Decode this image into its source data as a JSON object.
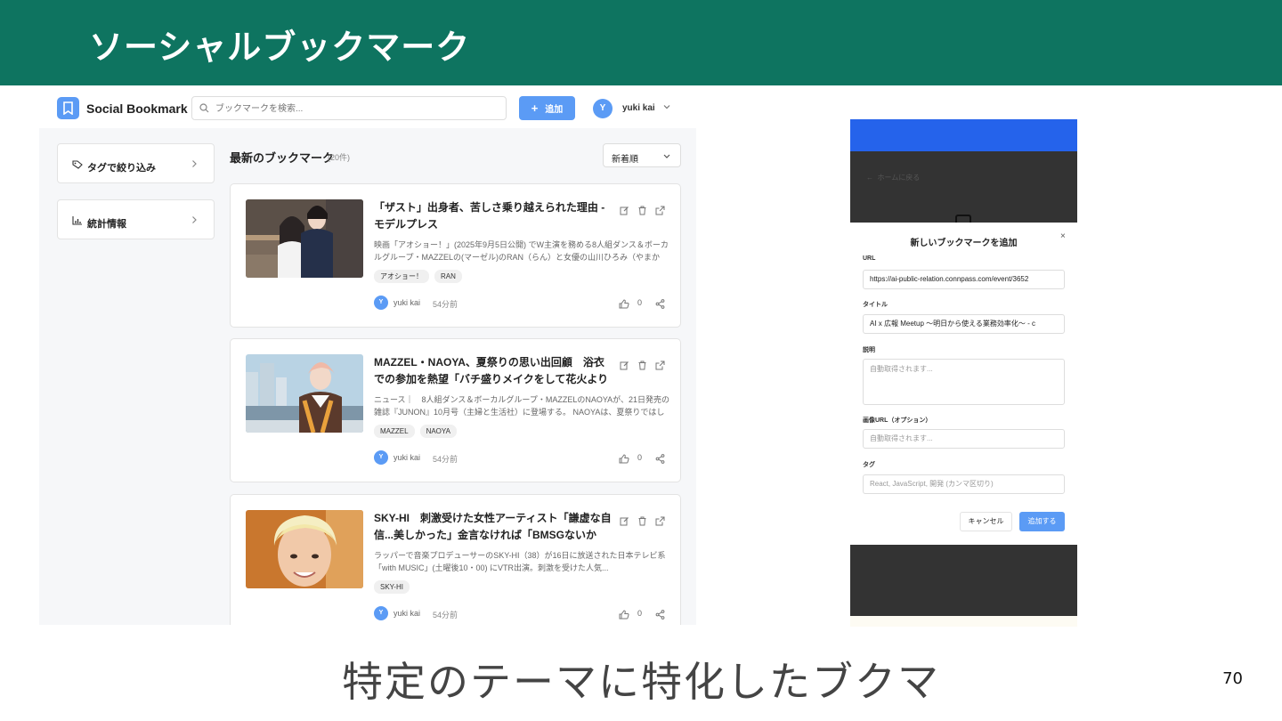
{
  "slide": {
    "title": "ソーシャルブックマーク",
    "caption": "特定のテーマに特化したブクマ",
    "page_number": "70"
  },
  "app": {
    "name": "Social Bookmark",
    "search_placeholder": "ブックマークを検索...",
    "add_label": "追加",
    "user_initial": "Y",
    "user_name": "yuki kai",
    "sidebar": [
      {
        "label": "タグで絞り込み",
        "icon": "tag-icon"
      },
      {
        "label": "統計情報",
        "icon": "bar-chart-icon"
      }
    ],
    "list_title": "最新のブックマーク",
    "list_count": "(20件)",
    "sort_value": "新着順",
    "bookmarks": [
      {
        "title": "「ザスト」出身者、苦しさ乗り越えられた理由 - モデルプレス",
        "description": "映画「アオショー！」(2025年9月5日公開) でW主演を務める8人組ダンス＆ボーカルグループ・MAZZELの(マーゼル)のRAN（らん）と女優の山川ひろみ（やまかわ・ひろ...",
        "tags": [
          "アオショー！",
          "RAN"
        ],
        "user_initial": "Y",
        "user": "yuki kai",
        "time": "54分前",
        "likes": "0"
      },
      {
        "title": "MAZZEL・NAOYA、夏祭りの思い出回顧　浴衣での参加を熱望「バチ盛りメイクをして花火よりも輝きたい」",
        "description": "ニュース｜　8人組ダンス＆ボーカルグループ・MAZZELのNAOYAが、21日発売の雑誌『JUNON』10月号（主婦と生活社）に登場する。 NAOYAは、夏祭りではしゃいだ...",
        "tags": [
          "MAZZEL",
          "NAOYA"
        ],
        "user_initial": "Y",
        "user": "yuki kai",
        "time": "54分前",
        "likes": "0"
      },
      {
        "title": "SKY-HI　刺激受けた女性アーティスト「謙虚な自信...美しかった」金言なければ「BMSGないかも」 - スポニ...",
        "description": "ラッパーで音楽プロデューサーのSKY-HI（38）が16日に放送された日本テレビ系「with MUSIC」(土曜後10・00) にVTR出演。刺激を受けた人気...",
        "tags": [
          "SKY-HI"
        ],
        "user_initial": "Y",
        "user": "yuki kai",
        "time": "54分前",
        "likes": "0"
      }
    ]
  },
  "modal": {
    "back_label": "ホームに戻る",
    "title": "新しいブックマークを追加",
    "close": "×",
    "url_label": "URL",
    "url_value": "https://ai-public-relation.connpass.com/event/3652",
    "title_label": "タイトル",
    "title_value": "AI x 広報 Meetup 〜明日から使える業務効率化〜 - c",
    "desc_label": "説明",
    "desc_placeholder": "自動取得されます...",
    "image_label": "画像URL（オプション）",
    "image_placeholder": "自動取得されます...",
    "tags_label": "タグ",
    "tags_placeholder": "React, JavaScript, 開発 (カンマ区切り)",
    "cancel_label": "キャンセル",
    "submit_label": "追加する"
  },
  "colors": {
    "banner": "#0e7460",
    "accent": "#5b9bf5",
    "modal_header": "#2563eb"
  }
}
